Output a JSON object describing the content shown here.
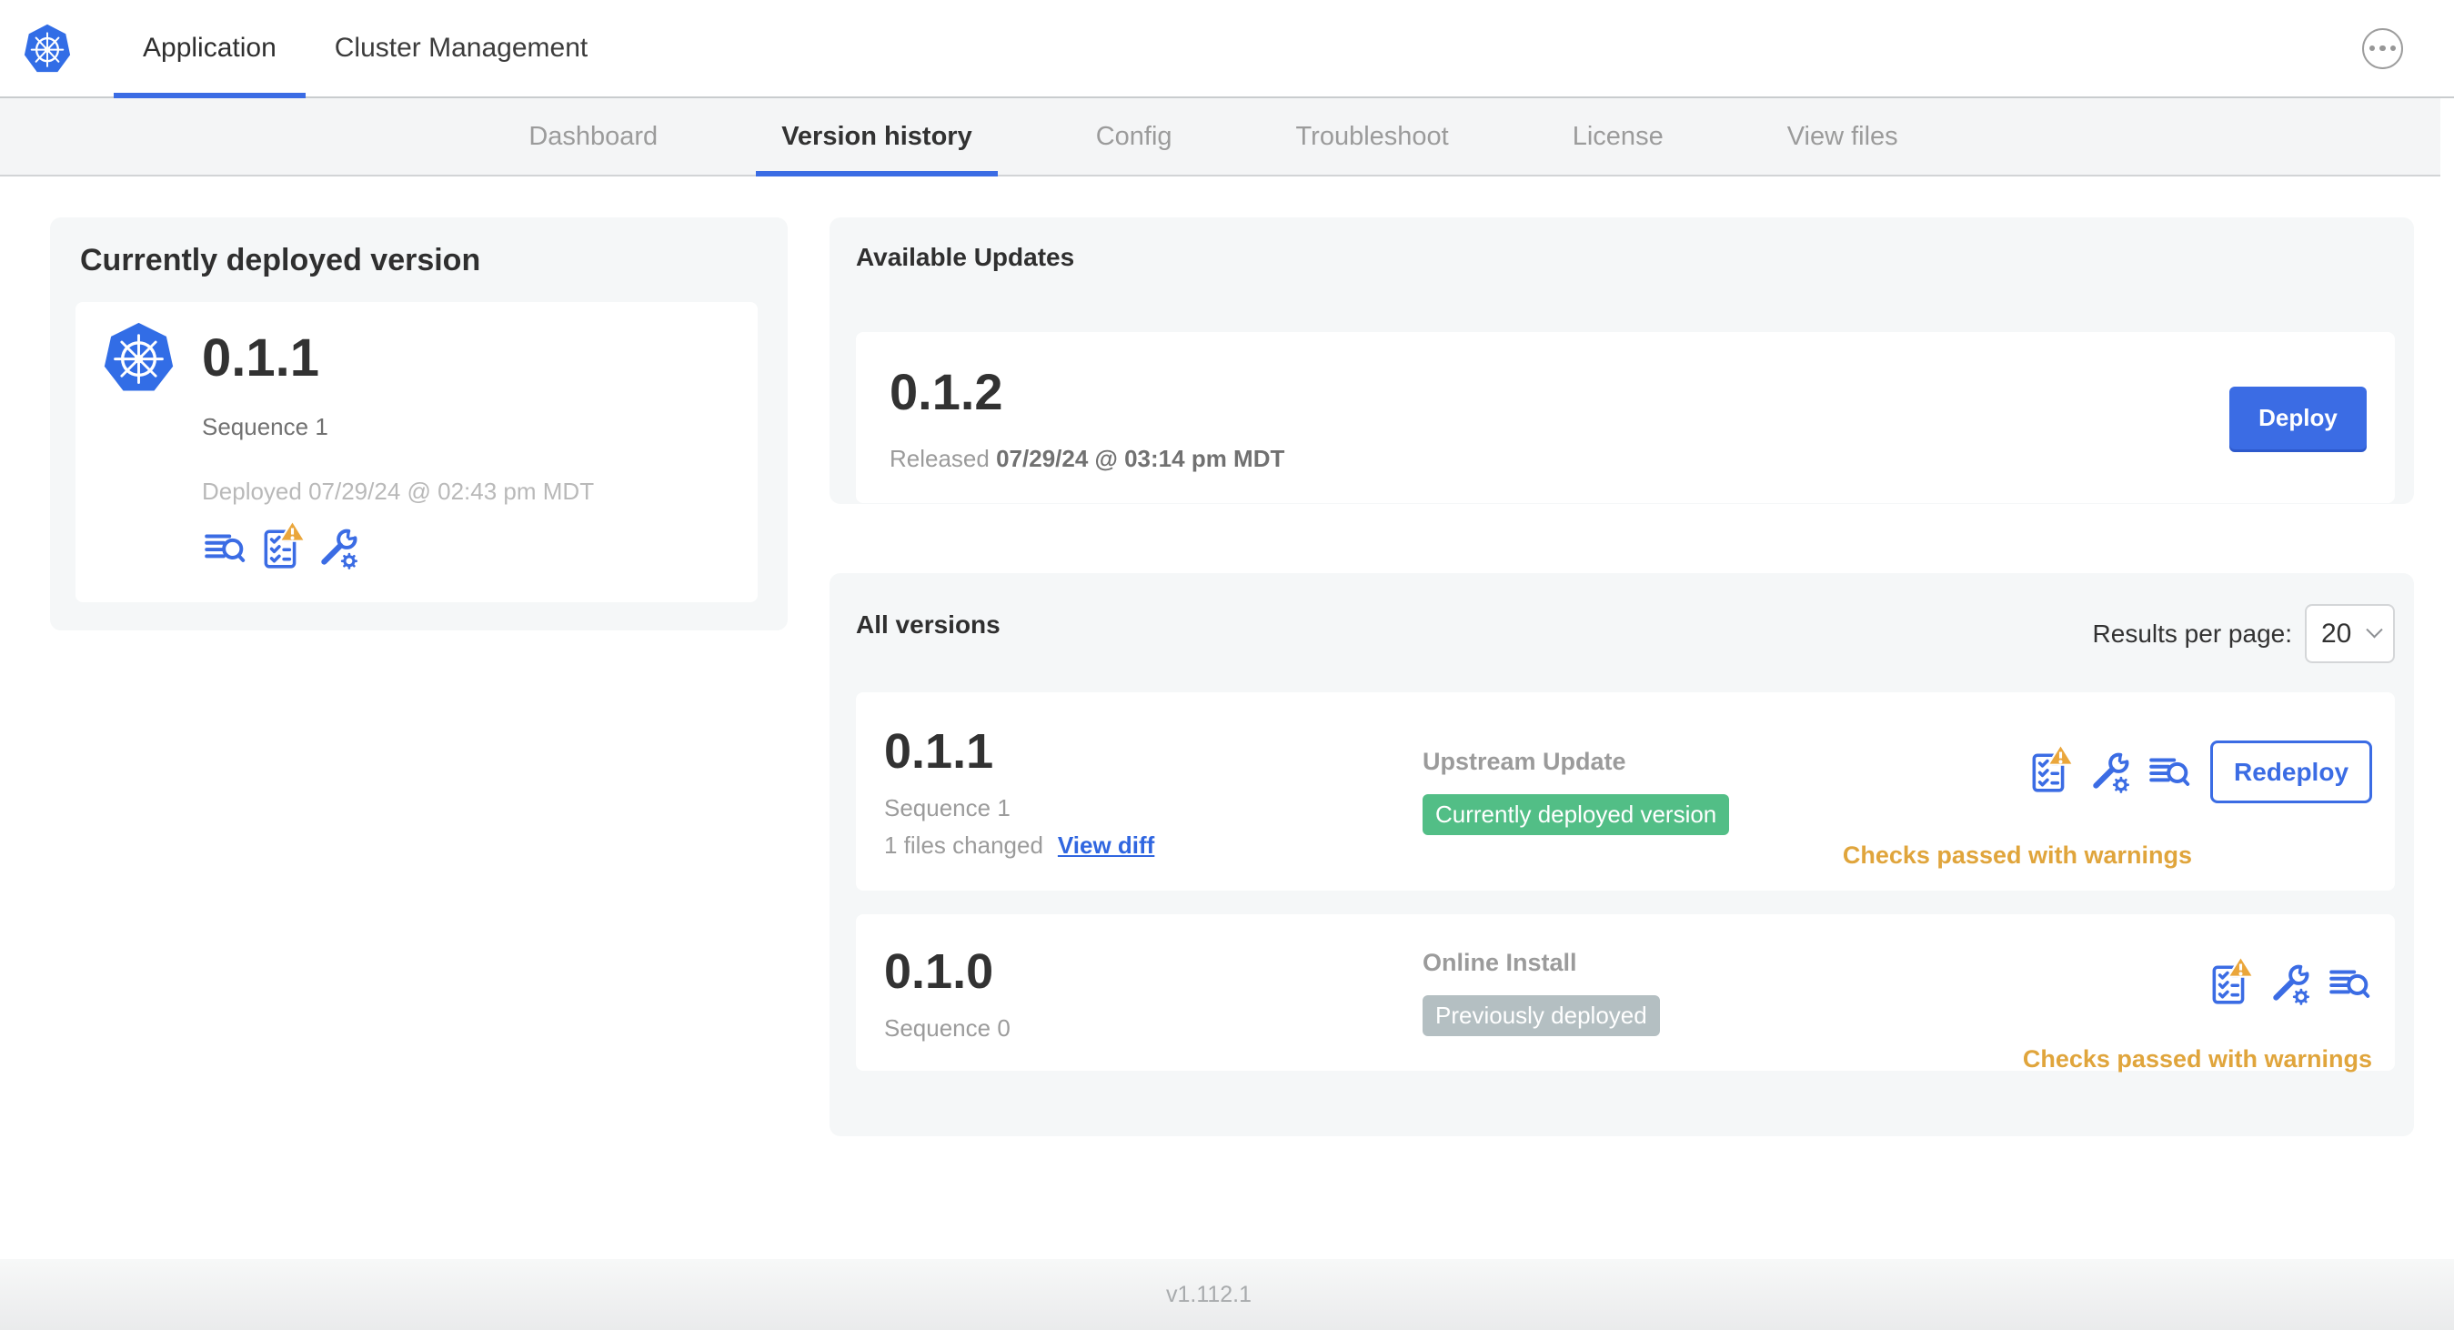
{
  "header": {
    "logo": "kubernetes-logo",
    "tabs": [
      {
        "label": "Application",
        "active": true
      },
      {
        "label": "Cluster Management",
        "active": false
      }
    ],
    "menu_icon": "ellipsis"
  },
  "subnav": {
    "tabs": [
      {
        "label": "Dashboard",
        "active": false
      },
      {
        "label": "Version history",
        "active": true
      },
      {
        "label": "Config",
        "active": false
      },
      {
        "label": "Troubleshoot",
        "active": false
      },
      {
        "label": "License",
        "active": false
      },
      {
        "label": "View files",
        "active": false
      }
    ]
  },
  "deployed": {
    "title": "Currently deployed version",
    "version": "0.1.1",
    "sequence": "Sequence 1",
    "deployed_at": "Deployed 07/29/24 @ 02:43 pm MDT",
    "icons": [
      "release-notes",
      "preflight-checks-warning",
      "config"
    ]
  },
  "available_updates": {
    "title": "Available Updates",
    "version": "0.1.2",
    "released_label": "Released",
    "released_at": "07/29/24 @ 03:14 pm MDT",
    "deploy_label": "Deploy"
  },
  "all_versions": {
    "title": "All versions",
    "results_per_page_label": "Results per page:",
    "results_per_page_value": "20",
    "rows": [
      {
        "version": "0.1.1",
        "sequence": "Sequence 1",
        "files_changed": "1 files changed",
        "view_diff_label": "View diff",
        "source": "Upstream Update",
        "badge": "Currently deployed version",
        "badge_color": "#52be86",
        "action_label": "Redeploy",
        "checks": "Checks passed with warnings",
        "icons": [
          "preflight-checks-warning",
          "config",
          "release-notes"
        ]
      },
      {
        "version": "0.1.0",
        "sequence": "Sequence 0",
        "source": "Online Install",
        "badge": "Previously deployed",
        "badge_color": "#b4bfc2",
        "checks": "Checks passed with warnings",
        "icons": [
          "preflight-checks-warning",
          "config",
          "release-notes"
        ]
      }
    ]
  },
  "footer": {
    "version": "v1.112.1"
  },
  "colors": {
    "accent_blue": "#3b6ce4",
    "logo_blue": "#326de6",
    "badge_green": "#52be86",
    "badge_gray": "#b4bfc2",
    "warning_text": "#e0a53c",
    "warning_triangle": "#eaa63b",
    "link_blue": "#3066e0"
  }
}
